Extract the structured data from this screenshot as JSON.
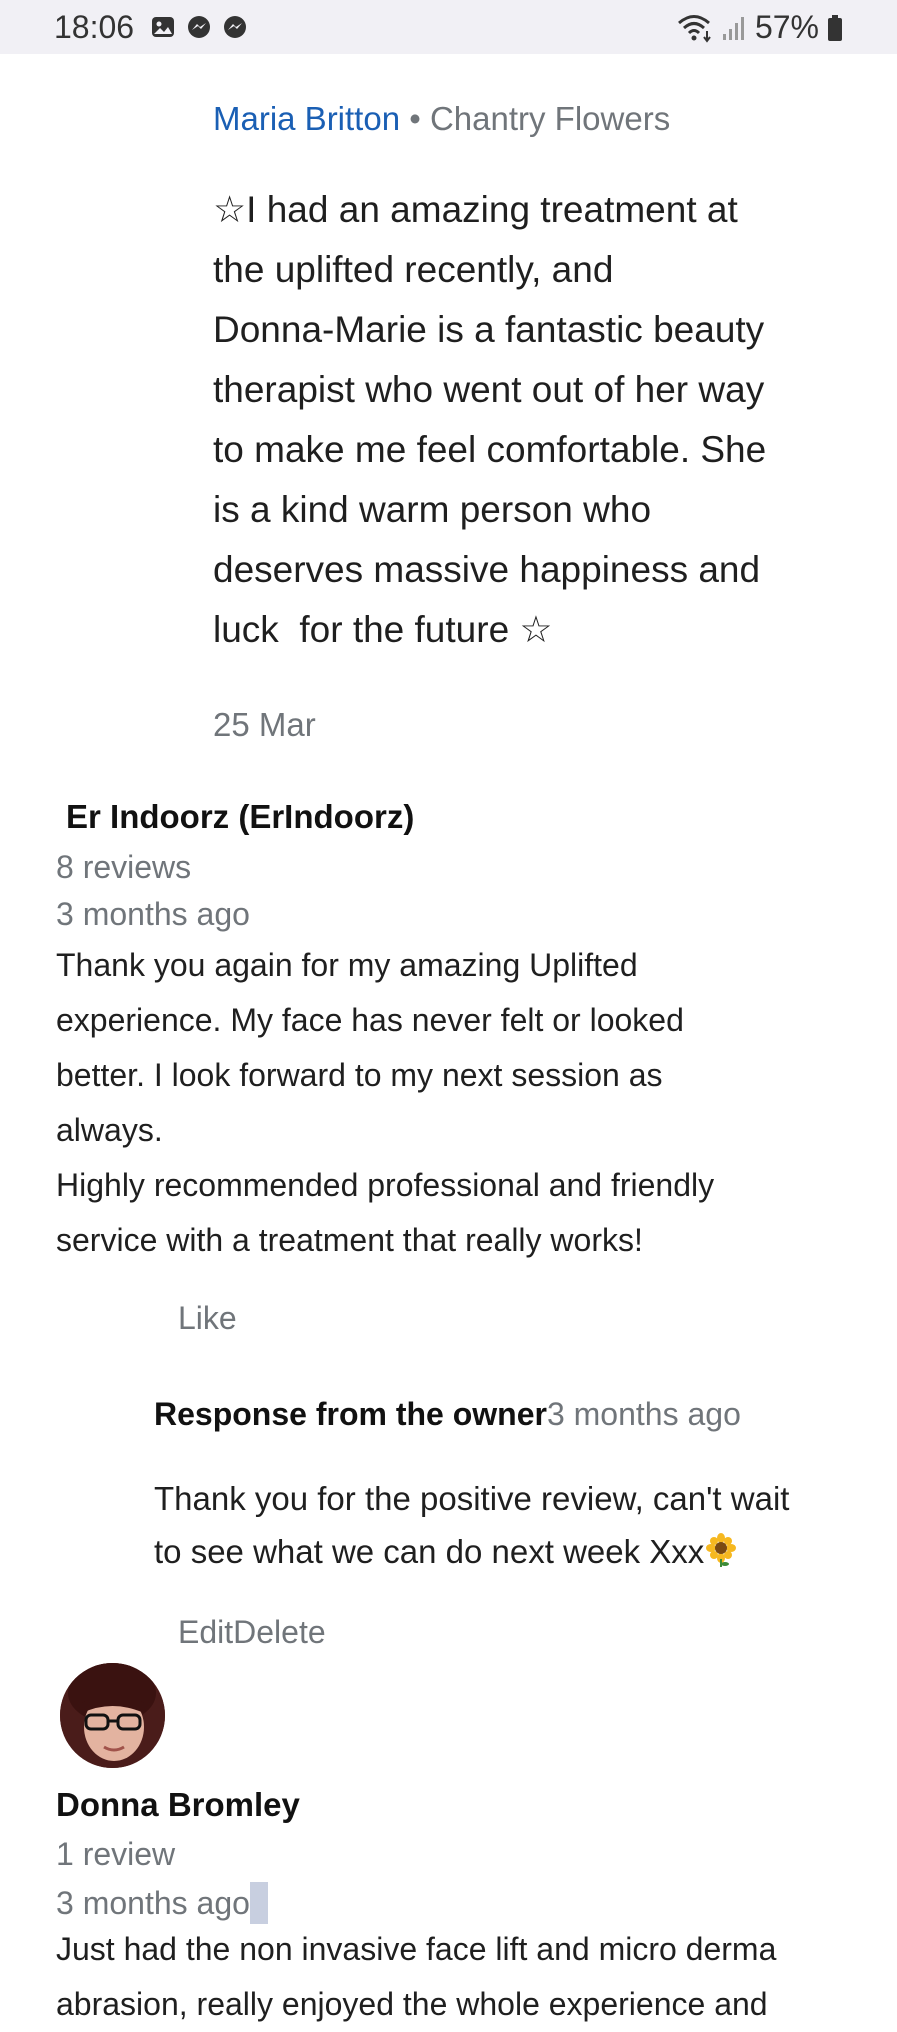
{
  "status_bar": {
    "time": "18:06",
    "battery": "57%",
    "left_icons": [
      "gallery-icon",
      "messenger-icon",
      "messenger-icon"
    ],
    "right_icons": [
      "wifi-icon",
      "signal-icon",
      "battery-icon"
    ]
  },
  "reply": {
    "author": "Maria Britton",
    "separator": "•",
    "business": "Chantry Flowers",
    "body_lines": [
      "☆I had an amazing treatment at",
      "the uplifted recently, and",
      "Donna-Marie is a fantastic beauty",
      "therapist who went out of her way",
      "to make me feel comfortable. She",
      "is a kind warm person who",
      "deserves massive happiness and",
      "luck  for the future ☆"
    ],
    "date": "25 Mar"
  },
  "review1": {
    "name": "Er Indoorz (ErIndoorz)",
    "review_count": "8 reviews",
    "time_ago": "3 months ago",
    "text_lines": [
      "Thank you again for my amazing Uplifted",
      "experience. My face has never felt or looked",
      "better. I look forward to my next session as",
      "always.",
      "Highly recommended professional and friendly",
      "service with a treatment that really works!"
    ],
    "like_label": "Like",
    "owner_response": {
      "label": "Response from the owner",
      "time_ago": "3 months ago",
      "text_line1": "Thank you for the positive review, can't wait",
      "text_line2": "to see what we can do next week Xxx",
      "emoji_icon": "sunflower-icon"
    },
    "edit_label": "Edit",
    "delete_label": "Delete"
  },
  "review2": {
    "name": "Donna Bromley",
    "review_count": "1 review",
    "time_ago": "3 months ago",
    "text_line1": "Just had the non invasive face lift and micro derma",
    "text_line2": "abrasion, really enjoyed the whole experience and"
  },
  "colors": {
    "link_blue": "#1a5fb4",
    "muted_gray": "#70757a",
    "status_bar_bg": "#f1f0f5"
  }
}
